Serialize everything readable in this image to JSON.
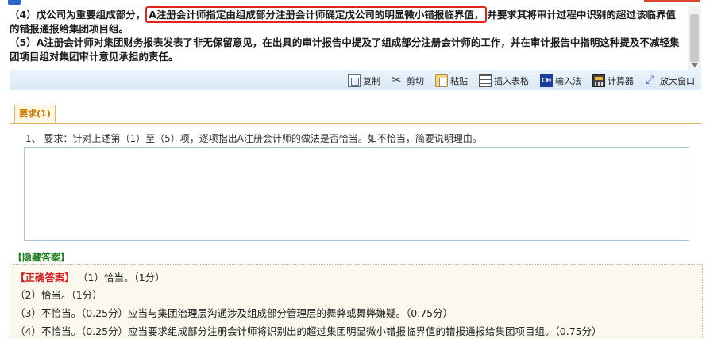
{
  "passage": {
    "line4_prefix": "（4）戊公司为重要组成部分，",
    "line4_highlight": "A注册会计师指定由组成部分注册会计师确定戊公司的明显微小错报临界值，",
    "line4_suffix": "并要求其将审计过程中识别的超过该临界值的错报通报给集团项目组。",
    "line5": "（5）A注册会计师对集团财务报表发表了非无保留意见，在出具的审计报告中提及了组成部分注册会计师的工作，并在审计报告中指明这种提及不减轻集团项目组对集团审计意见承担的责任。"
  },
  "toolbar": {
    "copy": "复制",
    "cut": "剪切",
    "paste": "粘贴",
    "insert_table": "插入表格",
    "input_method": "输入法",
    "calculator": "计算器",
    "maximize": "放大窗口",
    "input_method_badge": "CH"
  },
  "requirement": {
    "tab_label": "要求(1)",
    "text": "1、 要求：针对上述第（1）至（5）项，逐项指出A注册会计师的做法是否恰当。如不恰当，简要说明理由。",
    "answer_value": ""
  },
  "answer": {
    "hide_label": "【隐藏答案】",
    "correct_label": "【正确答案】",
    "lines": [
      "（1）恰当。（1分）",
      "（2）恰当。（1分）",
      "（3）不恰当。（0.25分）应当与集团治理层沟通涉及组成部分管理层的舞弊或舞弊嫌疑。（0.75分）",
      "（4）不恰当。（0.25分）应当要求组成部分注册会计师将识别出的超过集团明显微小错报临界值的错报通报给集团项目组。（0.75分）"
    ]
  }
}
